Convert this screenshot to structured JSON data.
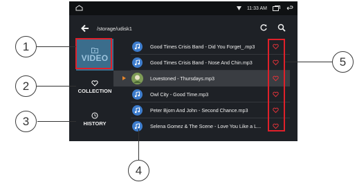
{
  "statusbar": {
    "time": "11:33 AM"
  },
  "path": {
    "text": "/storage/udisk1"
  },
  "sidebar": {
    "video_label": "VIDEO",
    "collection_label": "COLLECTION",
    "history_label": "HISTORY"
  },
  "songs": [
    "Good Times Crisis Band - Did You Forget_.mp3",
    "Good Times Crisis Band - Nose And Chin.mp3",
    "Lovestoned - Thursdays.mp3",
    "Owl City - Good Time.mp3",
    "Peter Bjorn And John - Second Chance.mp3",
    "Selena Gomez & The Scene - Love You Like a L..."
  ],
  "callouts": {
    "c1": "1",
    "c2": "2",
    "c3": "3",
    "c4": "4",
    "c5": "5"
  },
  "colors": {
    "accent": "#3b6d8c",
    "highlight_box": "#e0202a",
    "heart": "#e0333a",
    "note_icon_bg": "#3d7ccc"
  }
}
